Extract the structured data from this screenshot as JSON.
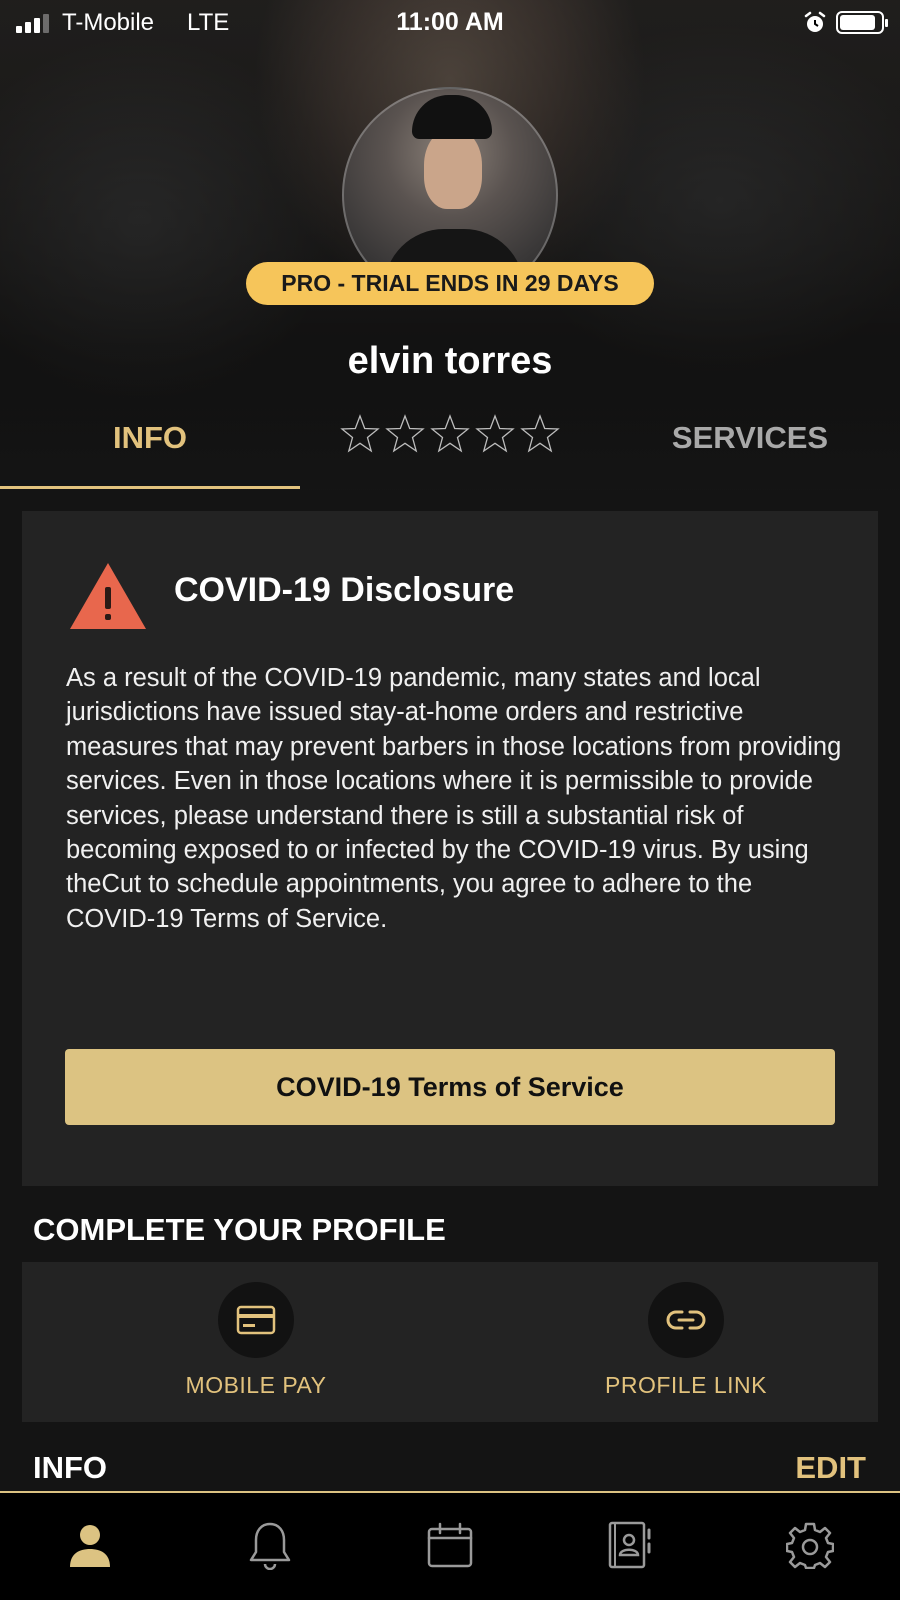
{
  "status_bar": {
    "carrier": "T-Mobile",
    "network": "LTE",
    "time": "11:00 AM"
  },
  "profile": {
    "badge": "PRO - TRIAL ENDS IN 29 DAYS",
    "name": "elvin torres",
    "rating_stars": 0,
    "rating_max": 5
  },
  "tabs": {
    "info": "INFO",
    "services": "SERVICES",
    "active": "INFO"
  },
  "covid": {
    "title": "COVID-19 Disclosure",
    "body": "As a result of the COVID-19 pandemic, many states and local jurisdictions have issued stay-at-home orders and restrictive measures that may prevent barbers in those locations from providing services. Even in those locations where it is permissible to provide services, please understand there is still a substantial risk of becoming exposed to or infected by the COVID-19 virus. By using theCut to schedule appointments, you agree to adhere to the COVID-19 Terms of Service.",
    "button": "COVID-19 Terms of Service"
  },
  "complete_profile": {
    "title": "COMPLETE YOUR PROFILE",
    "items": [
      {
        "label": "MOBILE PAY",
        "icon": "credit-card-icon"
      },
      {
        "label": "PROFILE LINK",
        "icon": "link-icon"
      }
    ]
  },
  "info_section": {
    "title": "INFO",
    "edit": "EDIT"
  },
  "bottom_nav": [
    {
      "icon": "profile-icon",
      "active": true
    },
    {
      "icon": "bell-icon",
      "active": false
    },
    {
      "icon": "calendar-icon",
      "active": false
    },
    {
      "icon": "contacts-icon",
      "active": false
    },
    {
      "icon": "settings-gear-icon",
      "active": false
    }
  ],
  "colors": {
    "accent": "#e2c27d",
    "badge": "#f6c55a",
    "button": "#dcc382",
    "warning": "#e8674d",
    "card": "#232323"
  }
}
